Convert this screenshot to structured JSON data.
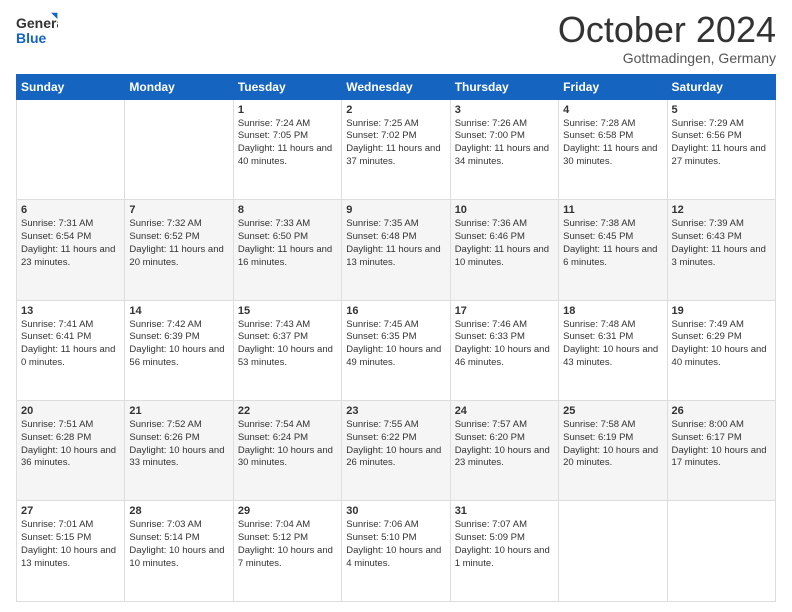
{
  "header": {
    "logo_general": "General",
    "logo_blue": "Blue",
    "month": "October 2024",
    "location": "Gottmadingen, Germany"
  },
  "weekdays": [
    "Sunday",
    "Monday",
    "Tuesday",
    "Wednesday",
    "Thursday",
    "Friday",
    "Saturday"
  ],
  "rows": [
    [
      {
        "day": "",
        "info": ""
      },
      {
        "day": "",
        "info": ""
      },
      {
        "day": "1",
        "info": "Sunrise: 7:24 AM\nSunset: 7:05 PM\nDaylight: 11 hours and 40 minutes."
      },
      {
        "day": "2",
        "info": "Sunrise: 7:25 AM\nSunset: 7:02 PM\nDaylight: 11 hours and 37 minutes."
      },
      {
        "day": "3",
        "info": "Sunrise: 7:26 AM\nSunset: 7:00 PM\nDaylight: 11 hours and 34 minutes."
      },
      {
        "day": "4",
        "info": "Sunrise: 7:28 AM\nSunset: 6:58 PM\nDaylight: 11 hours and 30 minutes."
      },
      {
        "day": "5",
        "info": "Sunrise: 7:29 AM\nSunset: 6:56 PM\nDaylight: 11 hours and 27 minutes."
      }
    ],
    [
      {
        "day": "6",
        "info": "Sunrise: 7:31 AM\nSunset: 6:54 PM\nDaylight: 11 hours and 23 minutes."
      },
      {
        "day": "7",
        "info": "Sunrise: 7:32 AM\nSunset: 6:52 PM\nDaylight: 11 hours and 20 minutes."
      },
      {
        "day": "8",
        "info": "Sunrise: 7:33 AM\nSunset: 6:50 PM\nDaylight: 11 hours and 16 minutes."
      },
      {
        "day": "9",
        "info": "Sunrise: 7:35 AM\nSunset: 6:48 PM\nDaylight: 11 hours and 13 minutes."
      },
      {
        "day": "10",
        "info": "Sunrise: 7:36 AM\nSunset: 6:46 PM\nDaylight: 11 hours and 10 minutes."
      },
      {
        "day": "11",
        "info": "Sunrise: 7:38 AM\nSunset: 6:45 PM\nDaylight: 11 hours and 6 minutes."
      },
      {
        "day": "12",
        "info": "Sunrise: 7:39 AM\nSunset: 6:43 PM\nDaylight: 11 hours and 3 minutes."
      }
    ],
    [
      {
        "day": "13",
        "info": "Sunrise: 7:41 AM\nSunset: 6:41 PM\nDaylight: 11 hours and 0 minutes."
      },
      {
        "day": "14",
        "info": "Sunrise: 7:42 AM\nSunset: 6:39 PM\nDaylight: 10 hours and 56 minutes."
      },
      {
        "day": "15",
        "info": "Sunrise: 7:43 AM\nSunset: 6:37 PM\nDaylight: 10 hours and 53 minutes."
      },
      {
        "day": "16",
        "info": "Sunrise: 7:45 AM\nSunset: 6:35 PM\nDaylight: 10 hours and 49 minutes."
      },
      {
        "day": "17",
        "info": "Sunrise: 7:46 AM\nSunset: 6:33 PM\nDaylight: 10 hours and 46 minutes."
      },
      {
        "day": "18",
        "info": "Sunrise: 7:48 AM\nSunset: 6:31 PM\nDaylight: 10 hours and 43 minutes."
      },
      {
        "day": "19",
        "info": "Sunrise: 7:49 AM\nSunset: 6:29 PM\nDaylight: 10 hours and 40 minutes."
      }
    ],
    [
      {
        "day": "20",
        "info": "Sunrise: 7:51 AM\nSunset: 6:28 PM\nDaylight: 10 hours and 36 minutes."
      },
      {
        "day": "21",
        "info": "Sunrise: 7:52 AM\nSunset: 6:26 PM\nDaylight: 10 hours and 33 minutes."
      },
      {
        "day": "22",
        "info": "Sunrise: 7:54 AM\nSunset: 6:24 PM\nDaylight: 10 hours and 30 minutes."
      },
      {
        "day": "23",
        "info": "Sunrise: 7:55 AM\nSunset: 6:22 PM\nDaylight: 10 hours and 26 minutes."
      },
      {
        "day": "24",
        "info": "Sunrise: 7:57 AM\nSunset: 6:20 PM\nDaylight: 10 hours and 23 minutes."
      },
      {
        "day": "25",
        "info": "Sunrise: 7:58 AM\nSunset: 6:19 PM\nDaylight: 10 hours and 20 minutes."
      },
      {
        "day": "26",
        "info": "Sunrise: 8:00 AM\nSunset: 6:17 PM\nDaylight: 10 hours and 17 minutes."
      }
    ],
    [
      {
        "day": "27",
        "info": "Sunrise: 7:01 AM\nSunset: 5:15 PM\nDaylight: 10 hours and 13 minutes."
      },
      {
        "day": "28",
        "info": "Sunrise: 7:03 AM\nSunset: 5:14 PM\nDaylight: 10 hours and 10 minutes."
      },
      {
        "day": "29",
        "info": "Sunrise: 7:04 AM\nSunset: 5:12 PM\nDaylight: 10 hours and 7 minutes."
      },
      {
        "day": "30",
        "info": "Sunrise: 7:06 AM\nSunset: 5:10 PM\nDaylight: 10 hours and 4 minutes."
      },
      {
        "day": "31",
        "info": "Sunrise: 7:07 AM\nSunset: 5:09 PM\nDaylight: 10 hours and 1 minute."
      },
      {
        "day": "",
        "info": ""
      },
      {
        "day": "",
        "info": ""
      }
    ]
  ]
}
